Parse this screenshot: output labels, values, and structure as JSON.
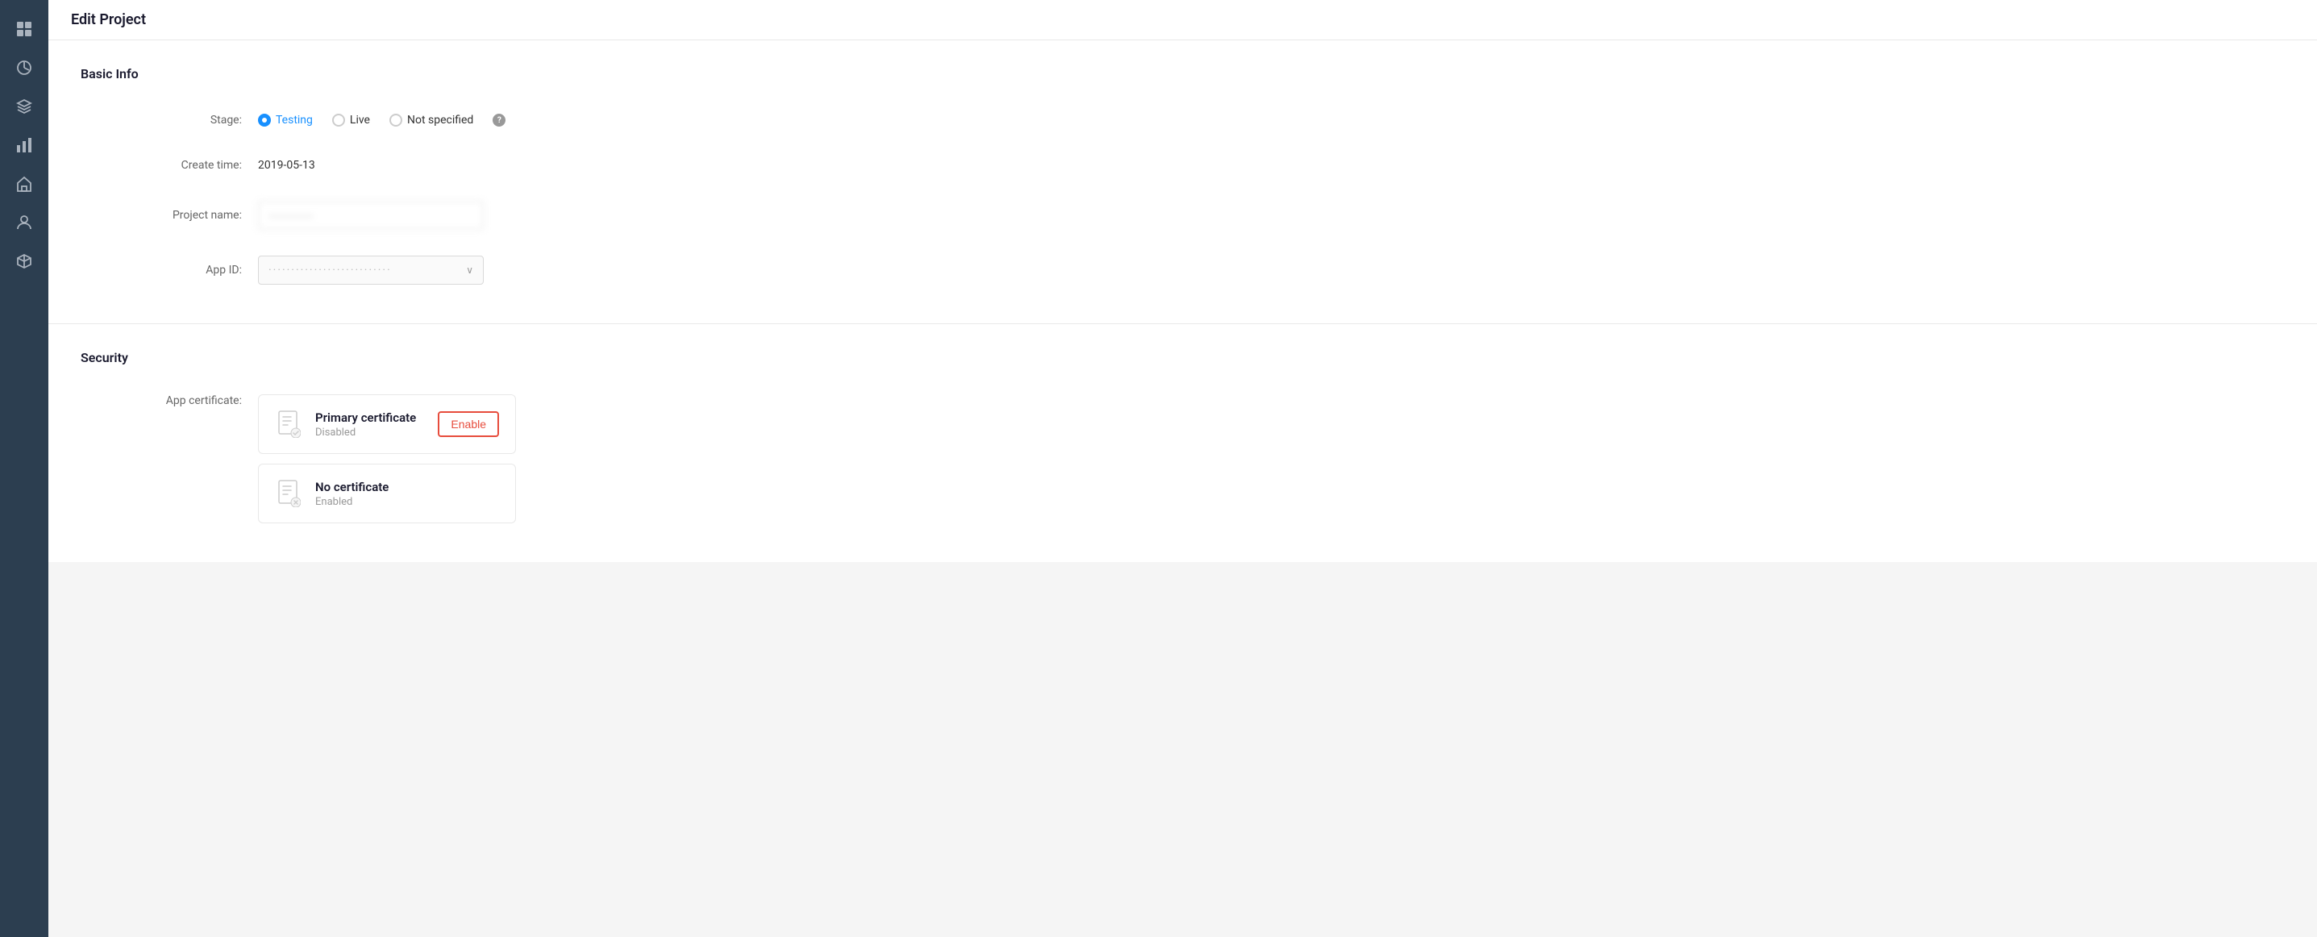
{
  "page": {
    "title": "Edit Project"
  },
  "sidebar": {
    "icons": [
      {
        "name": "grid-icon",
        "symbol": "⊞"
      },
      {
        "name": "chart-circle-icon",
        "symbol": "◎"
      },
      {
        "name": "layers-icon",
        "symbol": "≡"
      },
      {
        "name": "bar-chart-icon",
        "symbol": "▦"
      },
      {
        "name": "home-icon",
        "symbol": "⌂"
      },
      {
        "name": "person-icon",
        "symbol": "👤"
      },
      {
        "name": "cube-icon",
        "symbol": "⬡"
      }
    ]
  },
  "basic_info": {
    "section_title": "Basic Info",
    "stage_label": "Stage:",
    "stage_options": [
      {
        "id": "testing",
        "label": "Testing",
        "selected": true
      },
      {
        "id": "live",
        "label": "Live",
        "selected": false
      },
      {
        "id": "not_specified",
        "label": "Not specified",
        "selected": false
      }
    ],
    "create_time_label": "Create time:",
    "create_time_value": "2019-05-13",
    "project_name_label": "Project name:",
    "project_name_placeholder": "············",
    "app_id_label": "App ID:",
    "app_id_placeholder": "···························"
  },
  "security": {
    "section_title": "Security",
    "app_certificate_label": "App certificate:",
    "certificates": [
      {
        "id": "primary",
        "name": "Primary certificate",
        "status": "Disabled",
        "has_enable_button": true,
        "enable_label": "Enable"
      },
      {
        "id": "no_cert",
        "name": "No certificate",
        "status": "Enabled",
        "has_enable_button": false,
        "enable_label": ""
      }
    ]
  }
}
